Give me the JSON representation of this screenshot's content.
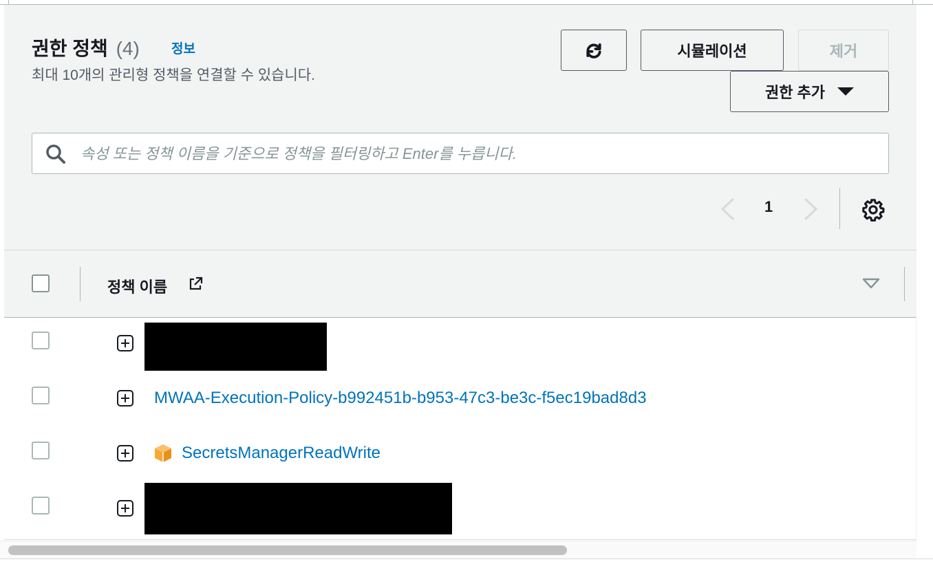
{
  "header": {
    "title": "권한 정책",
    "count": "(4)",
    "info_link": "정보",
    "subtitle": "최대 10개의 관리형 정책을 연결할 수 있습니다."
  },
  "toolbar": {
    "refresh_icon": "refresh-icon",
    "simulate_label": "시뮬레이션",
    "remove_label": "제거",
    "add_label": "권한 추가"
  },
  "search": {
    "placeholder": "속성 또는 정책 이름을 기준으로 정책을 필터링하고 Enter를 누릅니다.",
    "value": ""
  },
  "pagination": {
    "current_page": "1"
  },
  "table": {
    "columns": [
      "정책 이름"
    ],
    "rows": [
      {
        "name": "",
        "redacted": true,
        "aws_managed": false
      },
      {
        "name": "MWAA-Execution-Policy-b992451b-b953-47c3-be3c-f5ec19bad8d3",
        "redacted": false,
        "aws_managed": false
      },
      {
        "name": "SecretsManagerReadWrite",
        "redacted": false,
        "aws_managed": true
      },
      {
        "name": "",
        "redacted": true,
        "aws_managed": false
      }
    ]
  },
  "colors": {
    "link": "#0073bb",
    "panel_bg": "#f2f3f3",
    "border": "#aab7b8",
    "aws_icon": "#f7a934"
  }
}
